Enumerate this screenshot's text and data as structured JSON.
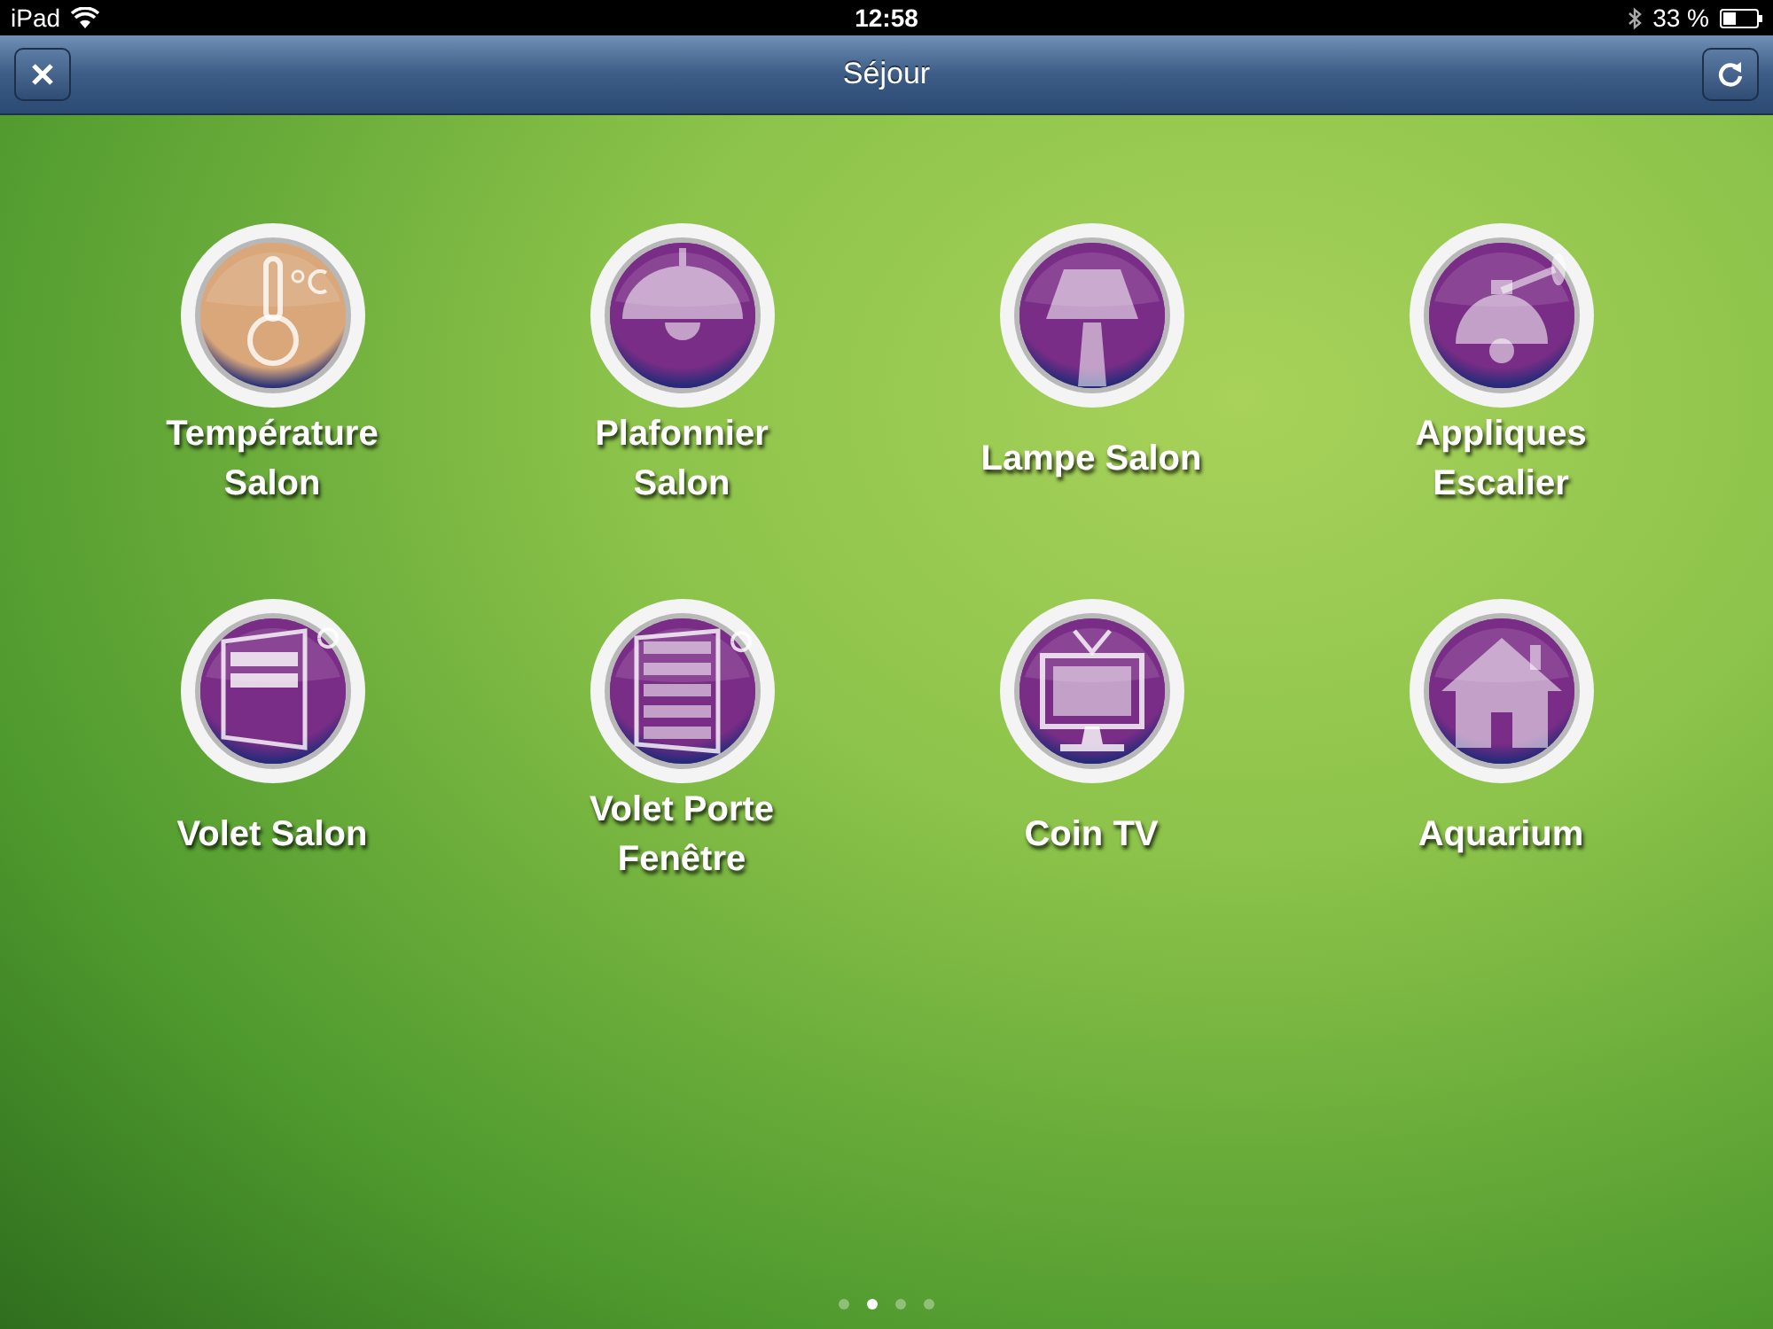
{
  "status_bar": {
    "device": "iPad",
    "time": "12:58",
    "battery": "33 %"
  },
  "nav_bar": {
    "title": "Séjour"
  },
  "tiles": [
    {
      "label": "Température Salon",
      "kind": "thermometer",
      "color": "#d9a77a"
    },
    {
      "label": "Plafonnier Salon",
      "kind": "ceiling-lamp",
      "color": "#7a2d86"
    },
    {
      "label": "Lampe Salon",
      "kind": "table-lamp",
      "color": "#7a2d86"
    },
    {
      "label": "Appliques Escalier",
      "kind": "wall-lamp",
      "color": "#7a2d86"
    },
    {
      "label": "Volet Salon",
      "kind": "shutter",
      "color": "#7a2d86"
    },
    {
      "label": "Volet Porte Fenêtre",
      "kind": "shutter-door",
      "color": "#7a2d86"
    },
    {
      "label": "Coin TV",
      "kind": "tv",
      "color": "#7a2d86"
    },
    {
      "label": "Aquarium",
      "kind": "house",
      "color": "#7a2d86"
    }
  ],
  "pages": [
    {
      "selected": false
    },
    {
      "selected": true
    },
    {
      "selected": false
    },
    {
      "selected": false
    }
  ]
}
